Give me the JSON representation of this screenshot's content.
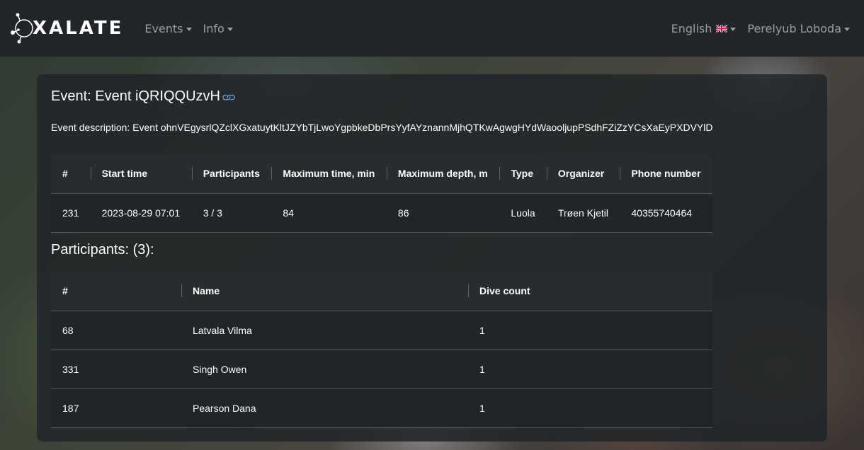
{
  "brand": {
    "name": "XALATE"
  },
  "nav": {
    "events_label": "Events",
    "info_label": "Info",
    "language_label": "English",
    "user_label": "Perelyub Loboda"
  },
  "event": {
    "title_prefix": "Event: ",
    "title": "Event iQRIQQUzvH",
    "description_prefix": "Event description: ",
    "description": "Event ohnVEgysrlQZclXGxatuytKltJZYbTjLwoYgpbkeDbPrsYyfAYznannMjhQTKwAgwgHYdWaooljupPSdhFZiZzYCsXaEyPXDVYlD"
  },
  "event_table": {
    "headers": [
      "#",
      "Start time",
      "Participants",
      "Maximum time, min",
      "Maximum depth, m",
      "Type",
      "Organizer",
      "Phone number"
    ],
    "row": [
      "231",
      "2023-08-29 07:01",
      "3 / 3",
      "84",
      "86",
      "Luola",
      "Trøen Kjetil",
      "40355740464"
    ]
  },
  "participants": {
    "title": "Participants: (3):",
    "headers": [
      "#",
      "Name",
      "Dive count"
    ],
    "rows": [
      [
        "68",
        "Latvala Vilma",
        "1"
      ],
      [
        "331",
        "Singh Owen",
        "1"
      ],
      [
        "187",
        "Pearson Dana",
        "1"
      ]
    ]
  },
  "colors": {
    "navbar": "#212529",
    "link": "#6ea8fe"
  },
  "icons": {
    "brand": "molecule-logo-icon",
    "link": "link-icon",
    "flag": "uk-flag-icon"
  }
}
